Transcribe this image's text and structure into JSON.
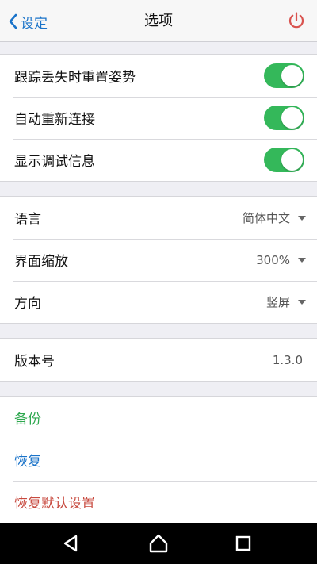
{
  "header": {
    "back_label": "设定",
    "title": "选项"
  },
  "toggles": [
    {
      "label": "跟踪丢失时重置姿势",
      "on": true
    },
    {
      "label": "自动重新连接",
      "on": true
    },
    {
      "label": "显示调试信息",
      "on": true
    }
  ],
  "selects": [
    {
      "label": "语言",
      "value": "简体中文"
    },
    {
      "label": "界面缩放",
      "value": "300%"
    },
    {
      "label": "方向",
      "value": "竖屏"
    }
  ],
  "version": {
    "label": "版本号",
    "value": "1.3.0"
  },
  "actions": {
    "backup": "备份",
    "restore": "恢复",
    "reset": "恢复默认设置"
  },
  "colors": {
    "accent": "#1a73c9",
    "toggle_on": "#34b85a",
    "backup": "#2ea84f",
    "restore": "#1a73c9",
    "reset": "#c84a3f",
    "power": "#d9534f"
  },
  "icons": [
    "chevron-left-icon",
    "power-icon",
    "nav-back-icon",
    "nav-home-icon",
    "nav-recents-icon"
  ]
}
